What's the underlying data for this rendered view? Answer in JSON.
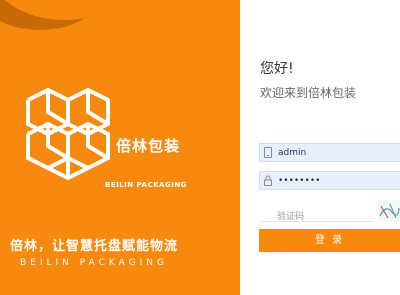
{
  "brand": {
    "name_cn": "倍林包装",
    "name_en": "BEILIN PACKAGING",
    "slogan": "倍林，让智慧托盘赋能物流",
    "slogan_en": "BEILIN   PACKAGING",
    "accent_color": "#f7890f"
  },
  "login": {
    "greeting": "您好!",
    "welcome": "欢迎来到倍林包装",
    "username": {
      "value": "admin",
      "icon": "phone-icon"
    },
    "password": {
      "value": "••••••••",
      "icon": "lock-icon"
    },
    "captcha": {
      "placeholder": "验证码"
    },
    "submit_label": "登 录"
  }
}
